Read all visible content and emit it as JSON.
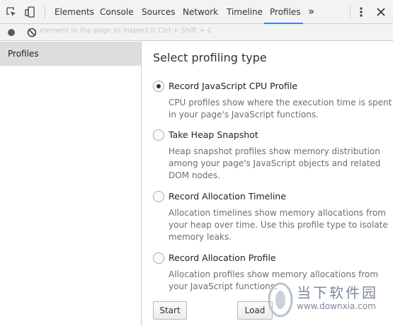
{
  "tabs": [
    {
      "label": "Elements",
      "active": false
    },
    {
      "label": "Console",
      "active": false
    },
    {
      "label": "Sources",
      "active": false
    },
    {
      "label": "Network",
      "active": false
    },
    {
      "label": "Timeline",
      "active": false
    },
    {
      "label": "Profiles",
      "active": true
    }
  ],
  "more_tabs": "»",
  "toolbar2": {
    "hint": "element in the page to inspect it  Ctrl + Shift + C"
  },
  "sidebar": {
    "items": [
      {
        "label": "Profiles",
        "selected": true
      }
    ]
  },
  "main": {
    "title": "Select profiling type",
    "options": [
      {
        "label": "Record JavaScript CPU Profile",
        "checked": true,
        "description": "CPU profiles show where the execution time is spent in your page's JavaScript functions."
      },
      {
        "label": "Take Heap Snapshot",
        "checked": false,
        "description": "Heap snapshot profiles show memory distribution among your page's JavaScript objects and related DOM nodes."
      },
      {
        "label": "Record Allocation Timeline",
        "checked": false,
        "description": "Allocation timelines show memory allocations from your heap over time. Use this profile type to isolate memory leaks."
      },
      {
        "label": "Record Allocation Profile",
        "checked": false,
        "description": "Allocation profiles show memory allocations from your JavaScript functions."
      }
    ],
    "start_label": "Start",
    "load_label": "Load"
  },
  "watermark": {
    "text": "当下软件园",
    "url": "www.downxia.com"
  },
  "colors": {
    "accent": "#3e82f7",
    "toolbar_bg": "#f3f3f3",
    "selected_bg": "#dddddd"
  }
}
